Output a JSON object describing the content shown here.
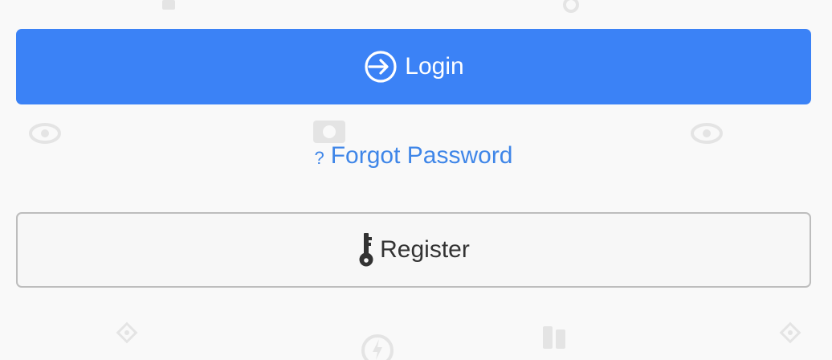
{
  "colors": {
    "accent": "#3b82f6",
    "link": "#3f86e8"
  },
  "login": {
    "label": "Login",
    "icon": "sign-in-icon"
  },
  "forgot": {
    "label": "Forgot Password",
    "icon_glyph": "?"
  },
  "register": {
    "label": "Register",
    "icon": "key-icon"
  }
}
